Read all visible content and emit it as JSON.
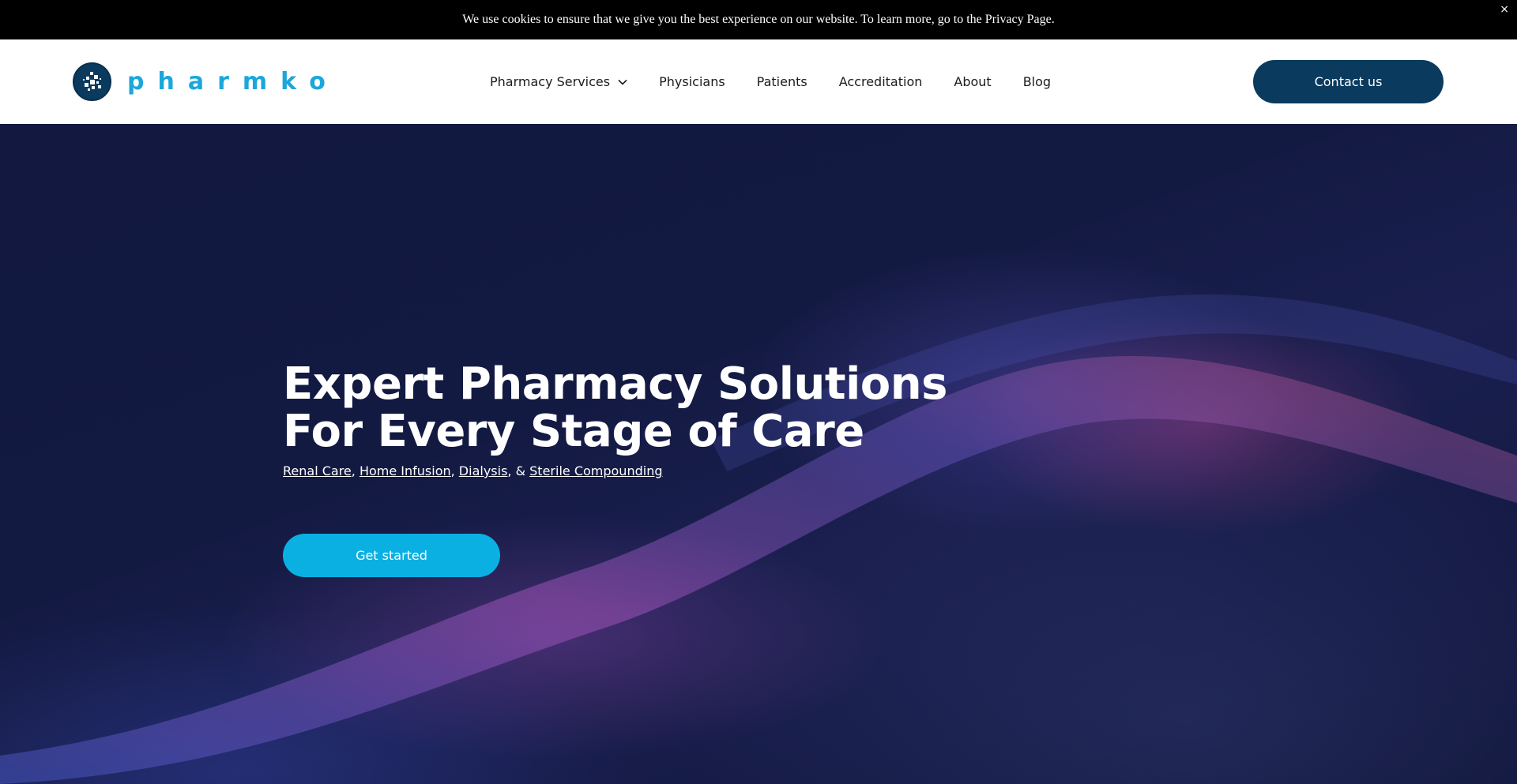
{
  "cookie_bar": {
    "message": "We use cookies to ensure that we give you the best experience on our website. To learn more, go to the Privacy Page.",
    "close_label": "×"
  },
  "header": {
    "logo_text": "pharmko",
    "nav": [
      {
        "label": "Pharmacy Services",
        "has_dropdown": true
      },
      {
        "label": "Physicians"
      },
      {
        "label": "Patients"
      },
      {
        "label": "Accreditation"
      },
      {
        "label": "About"
      },
      {
        "label": "Blog"
      }
    ],
    "contact_label": "Contact us"
  },
  "hero": {
    "title_line1": "Expert Pharmacy Solutions",
    "title_line2": "For Every Stage of Care",
    "links": [
      "Renal Care",
      "Home Infusion",
      "Dialysis",
      "Sterile Compounding"
    ],
    "separator_1": ", ",
    "separator_2": ", ",
    "separator_3": ", & ",
    "cta_label": "Get started"
  },
  "colors": {
    "accent": "#0bb0e3",
    "brand_dark": "#0a3a5e",
    "hero_bg": "#121840"
  }
}
